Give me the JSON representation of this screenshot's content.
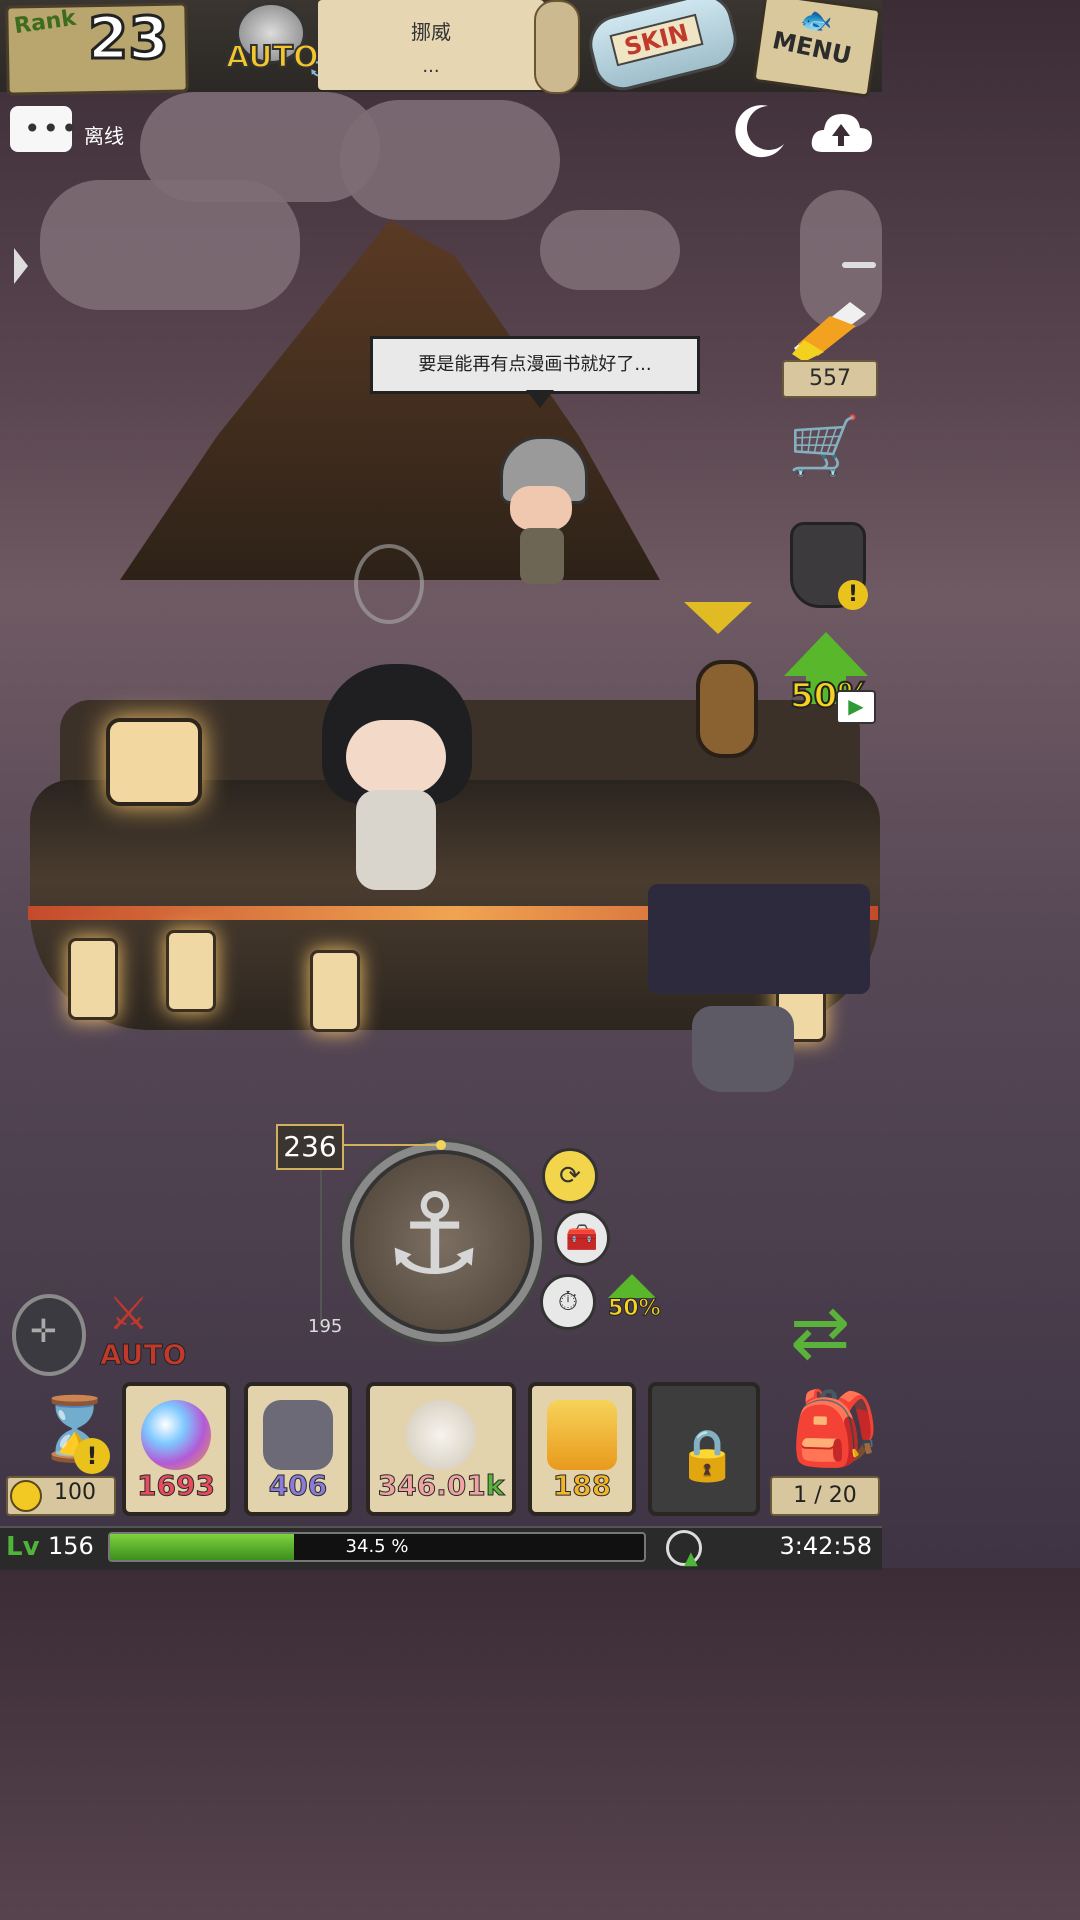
{
  "topbar": {
    "rank_label": "Rank",
    "rank_value": "23",
    "auto_label": "AUTO",
    "location_title": "挪威",
    "location_sub": "...",
    "skin_label": "SKIN",
    "menu_label": "MENU"
  },
  "status": {
    "chat_label": "离线"
  },
  "dialogue": {
    "text": "要是能再有点漫画书就好了..."
  },
  "sidebar": {
    "candy_count": "557",
    "boost_label": "50%"
  },
  "gauge": {
    "depth_current": "236",
    "depth_low": "195",
    "mini_boost_label": "50%"
  },
  "bottom_left": {
    "auto_battle_label": "AUTO"
  },
  "resources": {
    "coins": "100",
    "items": [
      {
        "value": "1693",
        "color": "#e84a5f",
        "icon": "rainbow-orb-icon"
      },
      {
        "value": "406",
        "color": "#8a7bd8",
        "icon": "dark-crest-icon"
      },
      {
        "value": "346.01",
        "suffix": "k",
        "color": "#f0a3a3",
        "icon": "spiral-shell-icon"
      },
      {
        "value": "188",
        "color": "#f2b52a",
        "icon": "amber-crystal-icon"
      }
    ],
    "bag_count": "1 / 20"
  },
  "levelbar": {
    "level_icon": "Lv",
    "level": "156",
    "progress_fraction": 0.345,
    "progress_text": "34.5 %",
    "timer": "3:42:58"
  }
}
